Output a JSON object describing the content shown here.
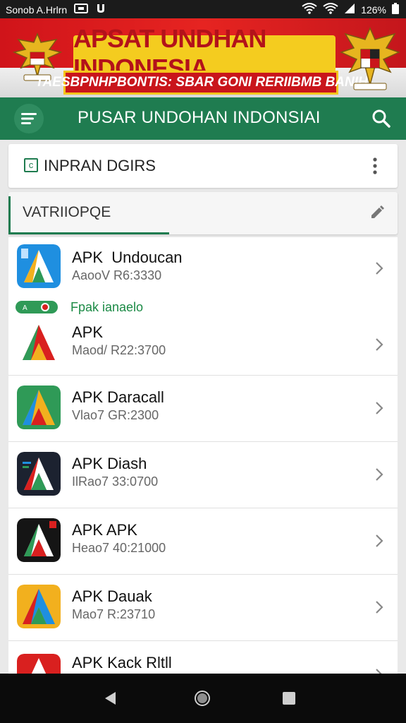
{
  "status_bar": {
    "carrier": "Sonob A.Hrlrn",
    "battery_pct": "126%"
  },
  "banner": {
    "title": "APSAT UNDHAN INDONESIA",
    "subtitle": "TAESBPNHPBONTIS: SBAR GONI RERIIBMB BANIH"
  },
  "app_bar": {
    "title": "PUSAR UNDOHAN INDONSIAI"
  },
  "filter_card": {
    "label": "INPRAN DGIRS"
  },
  "section_card": {
    "label": "VATRIIOPQE"
  },
  "promo": {
    "text": "Fpak ianaelo"
  },
  "apps": [
    {
      "name": "APK  Undoucan",
      "meta": "AaooV R6:3330",
      "icon": "apk-undoucan-icon",
      "color": "#1f8fe0"
    },
    {
      "name": "APK",
      "meta": "Maod/ R22:3700",
      "icon": "apk-icon",
      "color": "#d9201f"
    },
    {
      "name": "APK Daracall",
      "meta": "Vlao7 GR:2300",
      "icon": "apk-daracall-icon",
      "color": "#2f9a57"
    },
    {
      "name": "APK Diash",
      "meta": "IlRao7 33:0700",
      "icon": "apk-diash-icon",
      "color": "#1c2230"
    },
    {
      "name": "APK APK",
      "meta": "Heao7 40:21000",
      "icon": "apk-apk-icon",
      "color": "#151515"
    },
    {
      "name": "APK Dauak",
      "meta": "Mao7 R:23710",
      "icon": "apk-dauak-icon",
      "color": "#f2b01e"
    },
    {
      "name": "APK Kack Rltll",
      "meta": "",
      "icon": "apk-kack-icon",
      "color": "#d9201f"
    }
  ],
  "colors": {
    "primary": "#1f7c50",
    "banner_red": "#d0141a",
    "banner_yellow": "#f4cc1f"
  }
}
